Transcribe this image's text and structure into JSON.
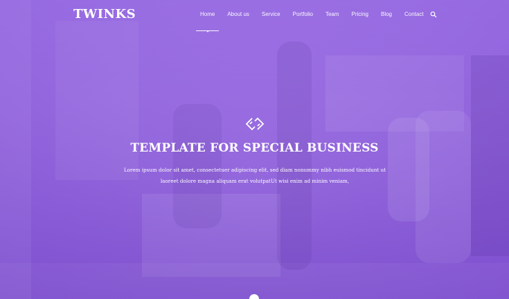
{
  "brand": {
    "name": "TWINKS"
  },
  "nav": {
    "items": [
      {
        "label": "Home",
        "active": true
      },
      {
        "label": "About us"
      },
      {
        "label": "Service"
      },
      {
        "label": "Portfolio"
      },
      {
        "label": "Team"
      },
      {
        "label": "Pricing"
      },
      {
        "label": "Blog"
      },
      {
        "label": "Contact"
      }
    ],
    "search_icon": "search-icon"
  },
  "hero": {
    "icon": "diamond-link-icon",
    "title": "TEMPLATE FOR SPECIAL BUSINESS",
    "line1": "Lorem ipsum dolor sit amet, consectetuer adipiscing elit, sed diam nonummy nibh euismod tincidunt ut",
    "line2": "laoreet dolore magna aliquam erat volutpatUt wisi enim ad minim veniam,"
  },
  "colors": {
    "overlay": "#9a6ee0",
    "text": "#ffffff"
  }
}
